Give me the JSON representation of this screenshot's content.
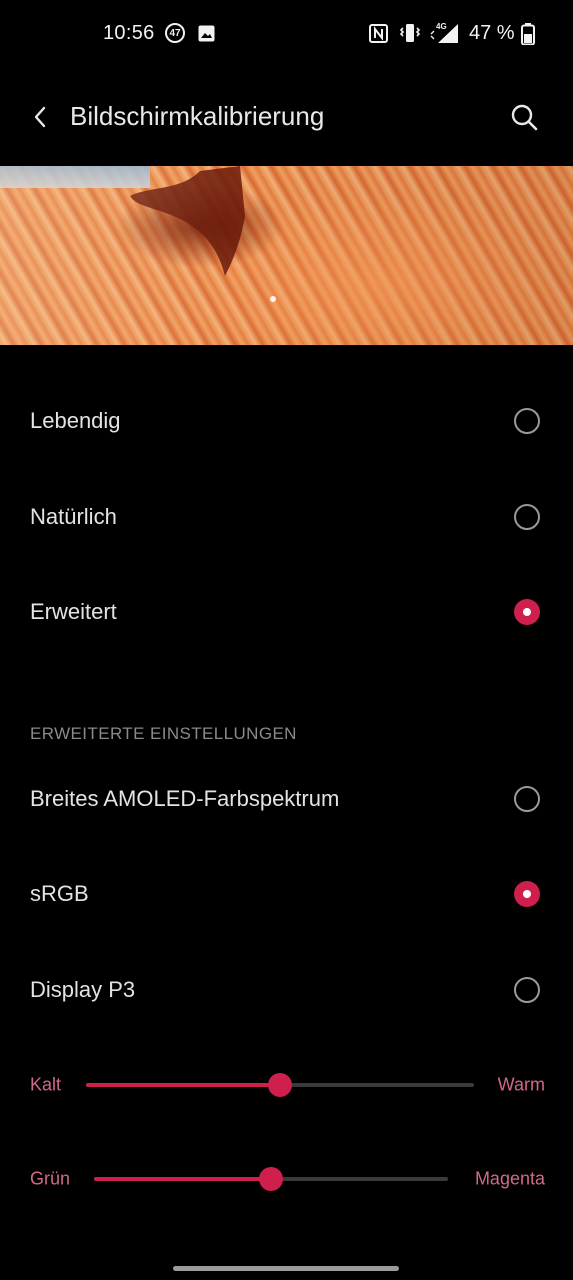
{
  "status_bar": {
    "time": "10:56",
    "notification_badge": "47",
    "battery_text": "47 %",
    "network_label": "4G",
    "icons": [
      "notification-badge-icon",
      "image-icon",
      "nfc-icon",
      "vibrate-icon",
      "signal-icon",
      "battery-icon"
    ]
  },
  "app_bar": {
    "title": "Bildschirmkalibrierung",
    "back_icon": "back-arrow-icon",
    "search_icon": "search-icon"
  },
  "banner": {
    "description_icon": "landscape-image",
    "page_indicator_count": 1
  },
  "modes": [
    {
      "label": "Lebendig",
      "selected": false
    },
    {
      "label": "Natürlich",
      "selected": false
    },
    {
      "label": "Erweitert",
      "selected": true
    }
  ],
  "advanced": {
    "heading": "ERWEITERTE EINSTELLUNGEN",
    "options": [
      {
        "label": "Breites AMOLED-Farbspektrum",
        "selected": false
      },
      {
        "label": "sRGB",
        "selected": true
      },
      {
        "label": "Display P3",
        "selected": false
      }
    ]
  },
  "sliders": [
    {
      "left_label": "Kalt",
      "right_label": "Warm",
      "value_fraction": 0.5
    },
    {
      "left_label": "Grün",
      "right_label": "Magenta",
      "value_fraction": 0.5
    }
  ],
  "colors": {
    "accent": "#cf1f4c",
    "background": "#000000",
    "slider_label": "#d06a86",
    "text": "#e3e3e3"
  }
}
